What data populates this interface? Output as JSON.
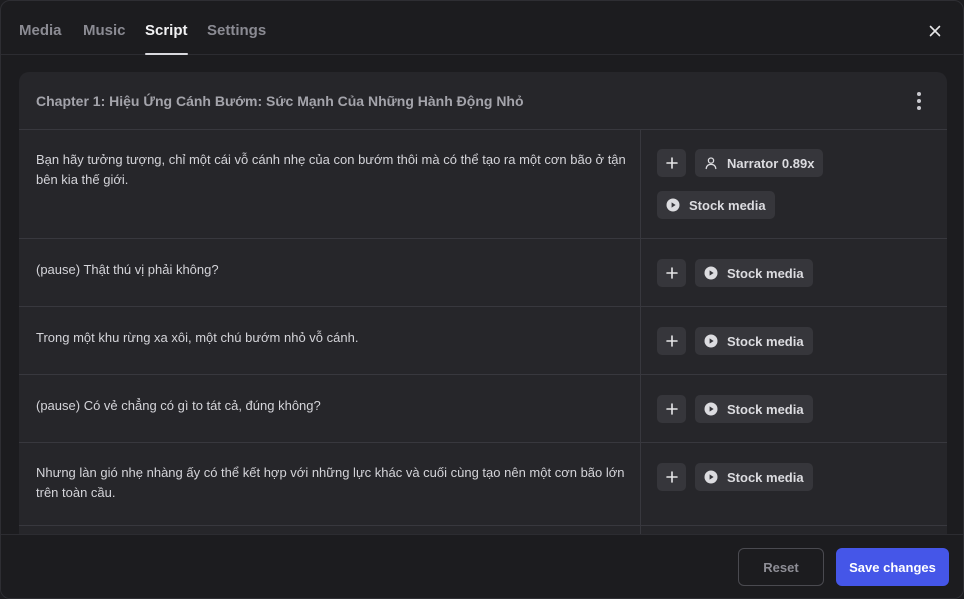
{
  "tabs": [
    {
      "label": "Media",
      "active": false
    },
    {
      "label": "Music",
      "active": false
    },
    {
      "label": "Script",
      "active": true
    },
    {
      "label": "Settings",
      "active": false
    }
  ],
  "chapter": {
    "title": "Chapter 1: Hiệu Ứng Cánh Bướm: Sức Mạnh Của Những Hành Động Nhỏ"
  },
  "rows": [
    {
      "text": "Bạn hãy tưởng tượng, chỉ một cái vỗ cánh nhẹ của con bướm thôi mà có thể tạo ra một cơn bão ở tận bên kia thế giới.",
      "narrator": "Narrator 0.89x",
      "media": "Stock media"
    },
    {
      "text": "(pause) Thật thú vị phải không?",
      "media": "Stock media"
    },
    {
      "text": "Trong một khu rừng xa xôi, một chú bướm nhỏ vỗ cánh.",
      "media": "Stock media"
    },
    {
      "text": "(pause) Có vẻ chẳng có gì to tát cả, đúng không?",
      "media": "Stock media"
    },
    {
      "text": "Nhưng làn gió nhẹ nhàng ấy có thể kết hợp với những lực khác và cuối cùng tạo nên một cơn bão lớn trên toàn cầu.",
      "media": "Stock media"
    }
  ],
  "footer": {
    "reset_label": "Reset",
    "save_label": "Save changes"
  },
  "colors": {
    "accent": "#4556e8",
    "background": "#1c1c1f",
    "card": "#26262a",
    "chip": "#36363b"
  },
  "icons": {
    "close": "close-icon",
    "more": "more-vertical-icon",
    "add": "plus-icon",
    "narrator": "user-icon",
    "media": "play-circle-icon"
  }
}
